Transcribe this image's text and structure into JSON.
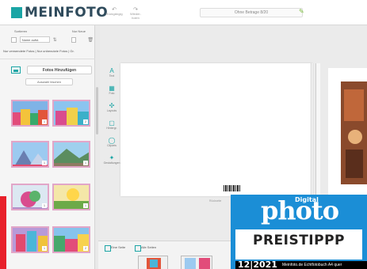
{
  "header": {
    "logo": "MEINFOTO",
    "undo_label": "Rück­gängig",
    "redo_label": "Wieder­holen",
    "book_title": "Ohne Betrage 8/20"
  },
  "left_panel": {
    "sort_labels": [
      "Sortieren",
      "Nur Neue"
    ],
    "sort_value": "Name aufst.",
    "filter_text": "Nur verwendete Fotos | Nur unbenutzte Fotos | Gr.",
    "add_photos_label": "Fotos Hinzufügen",
    "select_all_label": "Auswahl löschen",
    "thumb_badges": [
      "1",
      "2",
      "1",
      "1",
      "1",
      "1",
      "1",
      "2"
    ]
  },
  "tools": [
    {
      "name": "text",
      "icon": "A",
      "label": "Text"
    },
    {
      "name": "photo",
      "icon": "▦",
      "label": "Foto"
    },
    {
      "name": "layouts",
      "icon": "✣",
      "label": "Layouts"
    },
    {
      "name": "backgrounds",
      "icon": "▢",
      "label": "Hintergr."
    },
    {
      "name": "cliparts",
      "icon": "◯",
      "label": "Cliparts"
    },
    {
      "name": "effects",
      "icon": "✦",
      "label": "Gestaltungen"
    }
  ],
  "canvas": {
    "page_caption": "Rückseite"
  },
  "bottom": {
    "tab_one": "Eine Seite",
    "tab_all": "Alle Seiten"
  },
  "award": {
    "small": "Digital",
    "brand": "photo",
    "headline": "PREISTIPPP",
    "issue": "12|2021",
    "desc": "Meinfoto.de Echtfotobuch A4 quer"
  },
  "colors": {
    "accent": "#1aa5a5",
    "award_blue": "#1b8ed6",
    "thumb_border": "#e2a6c8"
  }
}
